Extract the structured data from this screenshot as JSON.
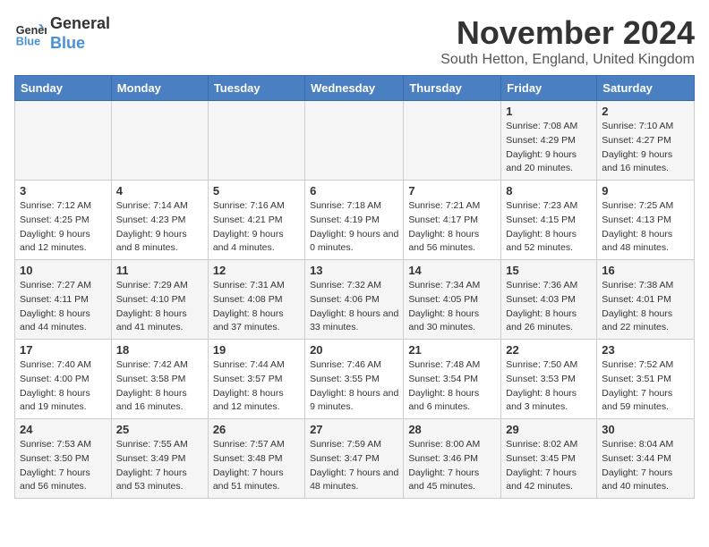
{
  "logo": {
    "line1": "General",
    "line2": "Blue"
  },
  "title": "November 2024",
  "location": "South Hetton, England, United Kingdom",
  "days_of_week": [
    "Sunday",
    "Monday",
    "Tuesday",
    "Wednesday",
    "Thursday",
    "Friday",
    "Saturday"
  ],
  "weeks": [
    [
      {
        "day": "",
        "info": ""
      },
      {
        "day": "",
        "info": ""
      },
      {
        "day": "",
        "info": ""
      },
      {
        "day": "",
        "info": ""
      },
      {
        "day": "",
        "info": ""
      },
      {
        "day": "1",
        "info": "Sunrise: 7:08 AM\nSunset: 4:29 PM\nDaylight: 9 hours and 20 minutes."
      },
      {
        "day": "2",
        "info": "Sunrise: 7:10 AM\nSunset: 4:27 PM\nDaylight: 9 hours and 16 minutes."
      }
    ],
    [
      {
        "day": "3",
        "info": "Sunrise: 7:12 AM\nSunset: 4:25 PM\nDaylight: 9 hours and 12 minutes."
      },
      {
        "day": "4",
        "info": "Sunrise: 7:14 AM\nSunset: 4:23 PM\nDaylight: 9 hours and 8 minutes."
      },
      {
        "day": "5",
        "info": "Sunrise: 7:16 AM\nSunset: 4:21 PM\nDaylight: 9 hours and 4 minutes."
      },
      {
        "day": "6",
        "info": "Sunrise: 7:18 AM\nSunset: 4:19 PM\nDaylight: 9 hours and 0 minutes."
      },
      {
        "day": "7",
        "info": "Sunrise: 7:21 AM\nSunset: 4:17 PM\nDaylight: 8 hours and 56 minutes."
      },
      {
        "day": "8",
        "info": "Sunrise: 7:23 AM\nSunset: 4:15 PM\nDaylight: 8 hours and 52 minutes."
      },
      {
        "day": "9",
        "info": "Sunrise: 7:25 AM\nSunset: 4:13 PM\nDaylight: 8 hours and 48 minutes."
      }
    ],
    [
      {
        "day": "10",
        "info": "Sunrise: 7:27 AM\nSunset: 4:11 PM\nDaylight: 8 hours and 44 minutes."
      },
      {
        "day": "11",
        "info": "Sunrise: 7:29 AM\nSunset: 4:10 PM\nDaylight: 8 hours and 41 minutes."
      },
      {
        "day": "12",
        "info": "Sunrise: 7:31 AM\nSunset: 4:08 PM\nDaylight: 8 hours and 37 minutes."
      },
      {
        "day": "13",
        "info": "Sunrise: 7:32 AM\nSunset: 4:06 PM\nDaylight: 8 hours and 33 minutes."
      },
      {
        "day": "14",
        "info": "Sunrise: 7:34 AM\nSunset: 4:05 PM\nDaylight: 8 hours and 30 minutes."
      },
      {
        "day": "15",
        "info": "Sunrise: 7:36 AM\nSunset: 4:03 PM\nDaylight: 8 hours and 26 minutes."
      },
      {
        "day": "16",
        "info": "Sunrise: 7:38 AM\nSunset: 4:01 PM\nDaylight: 8 hours and 22 minutes."
      }
    ],
    [
      {
        "day": "17",
        "info": "Sunrise: 7:40 AM\nSunset: 4:00 PM\nDaylight: 8 hours and 19 minutes."
      },
      {
        "day": "18",
        "info": "Sunrise: 7:42 AM\nSunset: 3:58 PM\nDaylight: 8 hours and 16 minutes."
      },
      {
        "day": "19",
        "info": "Sunrise: 7:44 AM\nSunset: 3:57 PM\nDaylight: 8 hours and 12 minutes."
      },
      {
        "day": "20",
        "info": "Sunrise: 7:46 AM\nSunset: 3:55 PM\nDaylight: 8 hours and 9 minutes."
      },
      {
        "day": "21",
        "info": "Sunrise: 7:48 AM\nSunset: 3:54 PM\nDaylight: 8 hours and 6 minutes."
      },
      {
        "day": "22",
        "info": "Sunrise: 7:50 AM\nSunset: 3:53 PM\nDaylight: 8 hours and 3 minutes."
      },
      {
        "day": "23",
        "info": "Sunrise: 7:52 AM\nSunset: 3:51 PM\nDaylight: 7 hours and 59 minutes."
      }
    ],
    [
      {
        "day": "24",
        "info": "Sunrise: 7:53 AM\nSunset: 3:50 PM\nDaylight: 7 hours and 56 minutes."
      },
      {
        "day": "25",
        "info": "Sunrise: 7:55 AM\nSunset: 3:49 PM\nDaylight: 7 hours and 53 minutes."
      },
      {
        "day": "26",
        "info": "Sunrise: 7:57 AM\nSunset: 3:48 PM\nDaylight: 7 hours and 51 minutes."
      },
      {
        "day": "27",
        "info": "Sunrise: 7:59 AM\nSunset: 3:47 PM\nDaylight: 7 hours and 48 minutes."
      },
      {
        "day": "28",
        "info": "Sunrise: 8:00 AM\nSunset: 3:46 PM\nDaylight: 7 hours and 45 minutes."
      },
      {
        "day": "29",
        "info": "Sunrise: 8:02 AM\nSunset: 3:45 PM\nDaylight: 7 hours and 42 minutes."
      },
      {
        "day": "30",
        "info": "Sunrise: 8:04 AM\nSunset: 3:44 PM\nDaylight: 7 hours and 40 minutes."
      }
    ]
  ]
}
